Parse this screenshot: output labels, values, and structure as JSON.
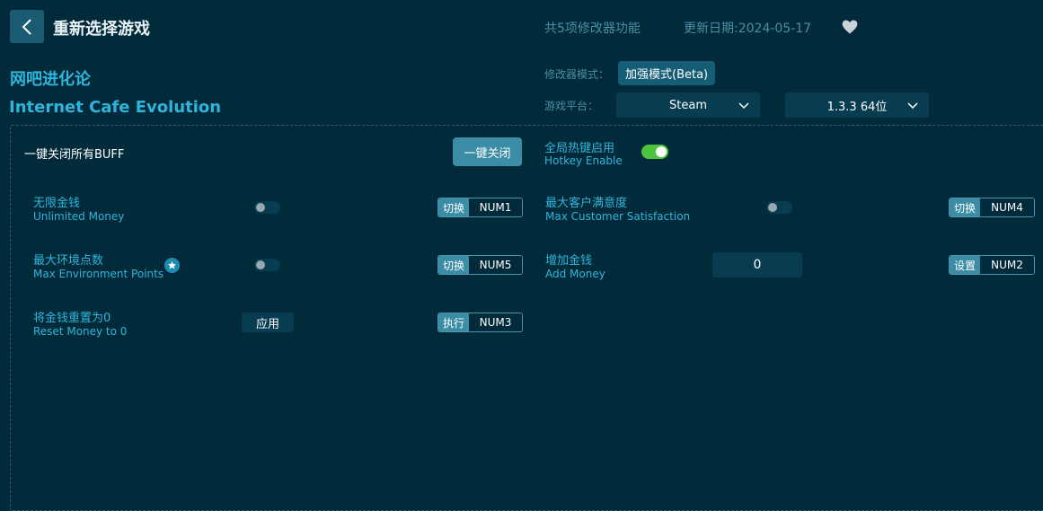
{
  "header": {
    "title": "重新选择游戏",
    "feature_count": "共5项修改器功能",
    "update_date": "更新日期:2024-05-17"
  },
  "game": {
    "name_cn": "网吧进化论",
    "name_en": "Internet Cafe Evolution"
  },
  "settings": {
    "mode_label": "修改器模式：",
    "mode_value": "加强模式(Beta)",
    "platform_label": "游戏平台：",
    "platform_value": "Steam",
    "version_value": "1.3.3 64位"
  },
  "global": {
    "all_off_label": "一键关闭所有BUFF",
    "all_off_button": "一键关闭",
    "hotkey_cn": "全局热键启用",
    "hotkey_en": "Hotkey Enable",
    "hotkey_enabled": true
  },
  "features": [
    {
      "name_cn": "无限金钱",
      "name_en": "Unlimited Money",
      "control": "toggle",
      "state": false,
      "action": "切换",
      "key": "NUM1"
    },
    {
      "name_cn": "最大客户满意度",
      "name_en": "Max Customer Satisfaction",
      "control": "toggle",
      "state": false,
      "action": "切换",
      "key": "NUM4"
    },
    {
      "name_cn": "最大环境点数",
      "name_en": "Max Environment Points",
      "control": "toggle",
      "state": false,
      "action": "切换",
      "key": "NUM5",
      "starred": true
    },
    {
      "name_cn": "增加金钱",
      "name_en": "Add Money",
      "control": "input",
      "value": "0",
      "action": "设置",
      "key": "NUM2"
    },
    {
      "name_cn": "将金钱重置为0",
      "name_en": "Reset Money to 0",
      "control": "button",
      "button_label": "应用",
      "action": "执行",
      "key": "NUM3"
    }
  ],
  "colors": {
    "background": "#012b3a",
    "accent": "#2fb5dc",
    "toggle_on": "#4cc43d",
    "button": "#3a8da4"
  },
  "icons": [
    "back-arrow-icon",
    "heart-icon",
    "chevron-down-icon",
    "star-icon"
  ]
}
